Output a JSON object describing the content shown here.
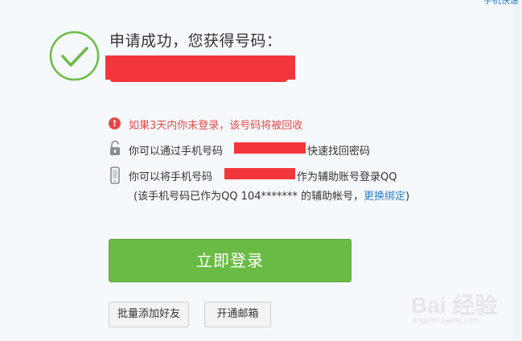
{
  "corner_link": "手机快速",
  "title": "申请成功，您获得号码：",
  "warning": {
    "icon": "exclamation-icon",
    "text": "如果3天内你未登录，该号码将被回收"
  },
  "recover": {
    "icon": "lock-icon",
    "before": "你可以通过手机号码",
    "after": "快速找回密码"
  },
  "aux_account": {
    "icon": "phone-icon",
    "before": "你可以将手机号码",
    "after": "作为辅助账号登录QQ",
    "note_before": "(该手机号码已作为QQ 104******* 的辅助帐号，",
    "note_link": "更换绑定",
    "note_after": ")"
  },
  "buttons": {
    "login": "立即登录",
    "add_friends": "批量添加好友",
    "open_mail": "开通邮箱"
  },
  "watermark": {
    "logo": "Bai 经验",
    "url": "jingyan.baidu.com"
  },
  "colors": {
    "accent_green": "#6abb45",
    "warning_red": "#e64b4b",
    "redaction": "#f2363b",
    "link_blue": "#2a7ecb"
  }
}
